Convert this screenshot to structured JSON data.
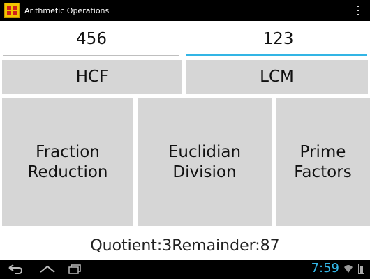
{
  "app": {
    "title": "Arithmetic Operations",
    "icon": "app-grid-icon",
    "icon_color": "#f3c400",
    "icon_accent": "#d0201b"
  },
  "inputs": {
    "first_value": "456",
    "second_value": "123"
  },
  "buttons": {
    "hcf": "HCF",
    "lcm": "LCM",
    "fraction_line1": "Fraction",
    "fraction_line2": "Reduction",
    "euclid_line1": "Euclidian",
    "euclid_line2": "Division",
    "prime_line1": "Prime",
    "prime_line2": "Factors"
  },
  "result": {
    "text": "Quotient:3Remainder:87"
  },
  "system_bar": {
    "time": "7:59",
    "accent": "#33b5e5"
  }
}
